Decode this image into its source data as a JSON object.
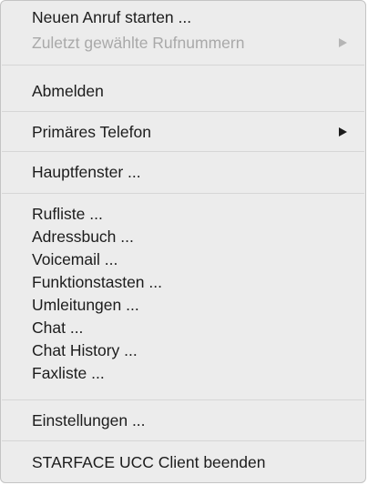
{
  "menu": {
    "items": [
      {
        "label": "Neuen Anruf starten ..."
      },
      {
        "label": "Zuletzt gewählte Rufnummern",
        "enabled": false,
        "submenu": true
      },
      {
        "label": "Abmelden"
      },
      {
        "label": "Primäres Telefon",
        "submenu": true
      },
      {
        "label": "Hauptfenster ..."
      },
      {
        "label": "Rufliste ..."
      },
      {
        "label": "Adressbuch ..."
      },
      {
        "label": "Voicemail ..."
      },
      {
        "label": "Funktionstasten ..."
      },
      {
        "label": "Umleitungen ..."
      },
      {
        "label": "Chat ..."
      },
      {
        "label": "Chat History ..."
      },
      {
        "label": "Faxliste ..."
      },
      {
        "label": "Einstellungen ..."
      },
      {
        "label": "STARFACE UCC Client beenden"
      }
    ]
  },
  "icons": {
    "submenu_arrow": "chevron-right-icon"
  },
  "colors": {
    "menu_background": "#ececec",
    "text": "#1c1c1c",
    "disabled_text": "#a9a9a9",
    "separator": "#d6d6d6"
  }
}
